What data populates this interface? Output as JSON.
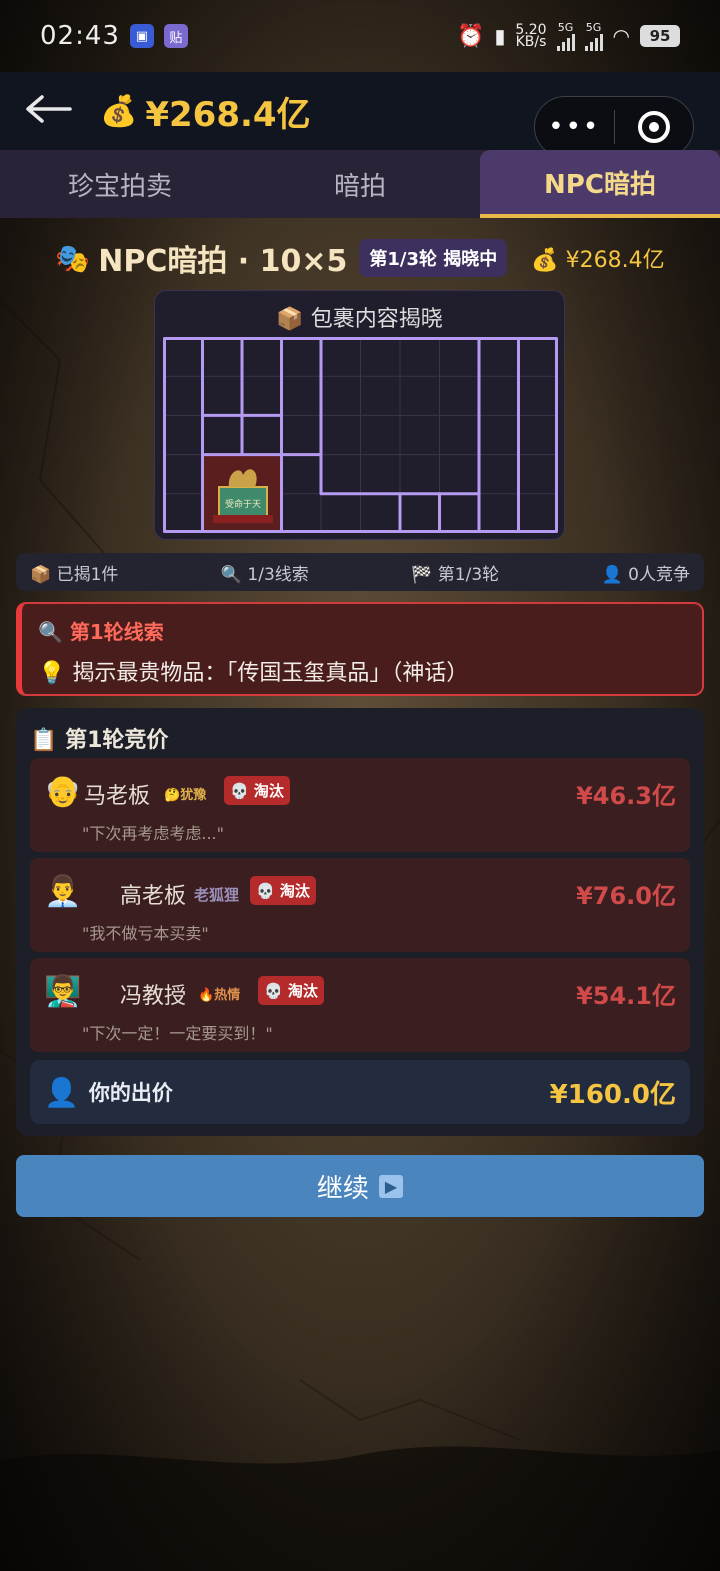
{
  "status_bar": {
    "time": "02:43",
    "net_speed_top": "5.20",
    "net_speed_bottom": "KB/s",
    "sim1": "5G",
    "sim2": "5G",
    "battery": "95"
  },
  "header": {
    "back_icon": "back-arrow-icon",
    "money_icon": "money-bag-icon",
    "money": "¥268.4亿",
    "capsule_more": "•••"
  },
  "tabs": [
    {
      "label": "珍宝拍卖"
    },
    {
      "label": "暗拍"
    },
    {
      "label": "NPC暗拍"
    }
  ],
  "active_tab": "NPC暗拍",
  "title": {
    "icon": "masks-icon",
    "text": "NPC暗拍 · 10×5",
    "round_badge": "第1/3轮 揭晓中",
    "money": "¥268.4亿"
  },
  "parcel": {
    "title": "包裹内容揭晓",
    "title_icon": "package-icon",
    "item_label": "传国玉玺真品"
  },
  "stats": {
    "revealed": "已揭1件",
    "clues": "1/3线索",
    "round": "第1/3轮",
    "competitors": "0人竞争"
  },
  "clue": {
    "heading": "第1轮线索",
    "text": "揭示最贵物品：「传国玉玺真品」（神话）"
  },
  "bids": {
    "heading": "第1轮竞价",
    "rows": [
      {
        "avatar": "👴",
        "name": "马老板",
        "mood_icon": "🤔",
        "mood": "犹豫",
        "status": "淘汰",
        "amount": "¥46.3亿",
        "quote": "\"下次再考虑考虑...\""
      },
      {
        "avatar": "👨‍💼",
        "name": "高老板",
        "mood_icon": "",
        "mood": "老狐狸",
        "status": "淘汰",
        "amount": "¥76.0亿",
        "quote": "\"我不做亏本买卖\""
      },
      {
        "avatar": "👨‍🏫",
        "name": "冯教授",
        "mood_icon": "🔥",
        "mood": "热情",
        "status": "淘汰",
        "amount": "¥54.1亿",
        "quote": "\"下次一定！一定要买到！\""
      }
    ],
    "your_label": "你的出价",
    "your_amount": "¥160.0亿"
  },
  "continue_button": {
    "label": "继续",
    "icon": "▶"
  },
  "colors": {
    "gold": "#f5c542",
    "tab_active": "#4b3a6a",
    "danger": "#d13b3b",
    "button": "#4a86bd"
  }
}
